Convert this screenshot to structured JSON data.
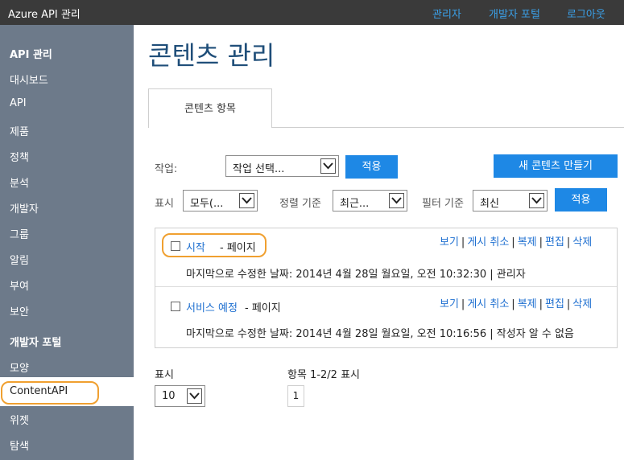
{
  "header": {
    "app_title": "Azure API 관리",
    "links": [
      "관리자",
      "개발자 포털",
      "로그아웃"
    ]
  },
  "sidebar": {
    "section_api": "API 관리",
    "items_api": [
      "대시보드",
      "API",
      "제품",
      "정책",
      "분석",
      "개발자",
      "그룹",
      "알림",
      "부여",
      "보안"
    ],
    "section_portal": "개발자 포털",
    "items_portal": [
      "모양",
      "ContentAPI",
      "위젯",
      "탐색"
    ],
    "selected": "ContentAPI"
  },
  "main": {
    "title": "콘텐츠 관리",
    "tab_label": "콘텐츠 항목",
    "action_label": "작업:",
    "action_select": "작업 선택...",
    "apply_label": "적용",
    "new_content_label": "새 콘텐츠 만들기",
    "show_label": "표시",
    "show_select": "모두(...",
    "sort_label": "정렬 기준",
    "sort_select": "최근...",
    "filter_label": "필터 기준",
    "filter_select": "최신",
    "apply2_label": "적용"
  },
  "items": [
    {
      "title": "시작",
      "type": "- 페이지",
      "meta": "마지막으로 수정한 날짜: 2014년 4월 28일 월요일, 오전 10:32:30 | 관리자",
      "actions": [
        "보기",
        "게시 취소",
        "복제",
        "편집",
        "삭제"
      ]
    },
    {
      "title": "서비스 예정",
      "type": "- 페이지",
      "meta": "마지막으로 수정한 날짜: 2014년 4월 28일 월요일, 오전 10:16:56 | 작성자 알 수 없음",
      "actions": [
        "보기",
        "게시 취소",
        "복제",
        "편집",
        "삭제"
      ]
    }
  ],
  "pager": {
    "show_label": "표시",
    "page_size": "10",
    "range_label": "항목 1-2/2 표시",
    "page": "1"
  },
  "colors": {
    "topbar": "#3a3a3a",
    "sidebar": "#6d7a8a",
    "accent": "#1e88e5",
    "link": "#1e6fd0",
    "highlight": "#f0a030"
  }
}
